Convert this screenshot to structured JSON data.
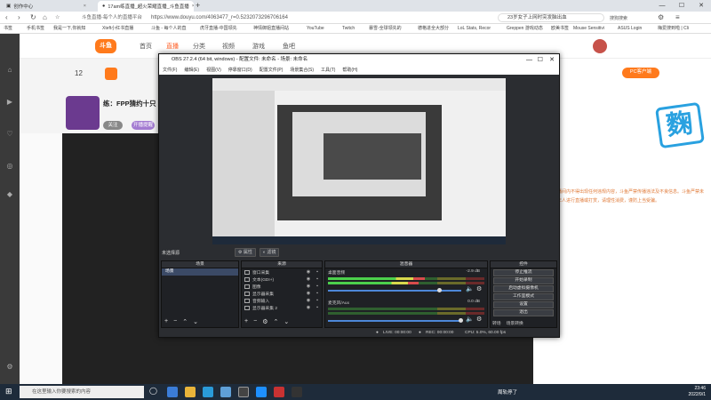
{
  "browser": {
    "tabs": [
      {
        "label": "创作中心",
        "active": false
      },
      {
        "label": "17am练直播_超火荣耀直播_斗鱼直播",
        "active": true
      }
    ],
    "url_title": "斗鱼直播-每个人的直播平台",
    "url": "https://www.douyu.com/4063477_r=0.5232073296706164",
    "search_text": "23岁女子上网时突发脑出血",
    "search_label": "搜狗搜索",
    "bookmarks": [
      "书签",
      "手机书签",
      "我是一下,你就知",
      "Xteft小红书直播",
      "斗鱼 - 每个人的直",
      "虎牙直播-中国领先",
      "神情御姐直播间站",
      "YouTube",
      "Twitch",
      "暴雪-全球领先的",
      "德格进全大部分",
      "LoL Stats, Recor",
      "Greppen 游戏动态",
      "欧美书签",
      "Mouse Sensitivi",
      "ASUS Login",
      "梅爱搜到啦 | Cli"
    ]
  },
  "douyu": {
    "logo": "斗鱼",
    "nav": [
      "首页",
      "直播",
      "分类",
      "视频",
      "游戏",
      "鱼吧"
    ],
    "room_title": "练：FPP猜约十只",
    "follow_count": "12",
    "side_big_char": "麴",
    "btn_follow": "关注",
    "btn_open": "开播提醒",
    "btn_pc": "PC客户端",
    "side_text": "直播间内不得出现任何违规内容，斗鱼严禁传播违法及不良信息。斗鱼严禁未成年人进行直播或打赏，请理性消费，谨防上当受骗。"
  },
  "obs": {
    "title": "OBS 27.2.4 (64 bit, windows) - 配置文件: 未命名 - 场景: 未命名",
    "menu": [
      "文件(F)",
      "编辑(E)",
      "视图(V)",
      "停靠窗口(D)",
      "配置文件(P)",
      "场景集合(S)",
      "工具(T)",
      "帮助(H)"
    ],
    "not_in_scene": "未选择源",
    "props_btn": "属性",
    "filters_btn": "滤镜",
    "scenes_header": "场景",
    "scenes": [
      "场景"
    ],
    "sources_header": "来源",
    "sources": [
      "窗口采集",
      "文本(GDI+)",
      "图像",
      "显示器采集",
      "音频输入",
      "显示器采集 2"
    ],
    "mixer_header": "混音器",
    "mixer": [
      {
        "name": "桌面音频",
        "db": "-2.9 dB"
      },
      {
        "name": "麦克风/Aux",
        "db": "0.0 dB"
      }
    ],
    "controls_header": "控件",
    "controls": [
      "停止推流",
      "开始录制",
      "启动虚拟摄像机",
      "工作室模式",
      "设置",
      "退出"
    ],
    "transitions_label": "转场",
    "dock_tab2": "场景转换",
    "status": {
      "live": "LIVE: 00:00:00",
      "rec": "REC: 00:00:00",
      "cpu": "CPU: 5.0%, 60.00 fps"
    }
  },
  "taskbar": {
    "search_placeholder": "在这里输入你要搜索的内容",
    "weather": "周轨停了",
    "time": "23:46",
    "date": "2022/9/1"
  }
}
